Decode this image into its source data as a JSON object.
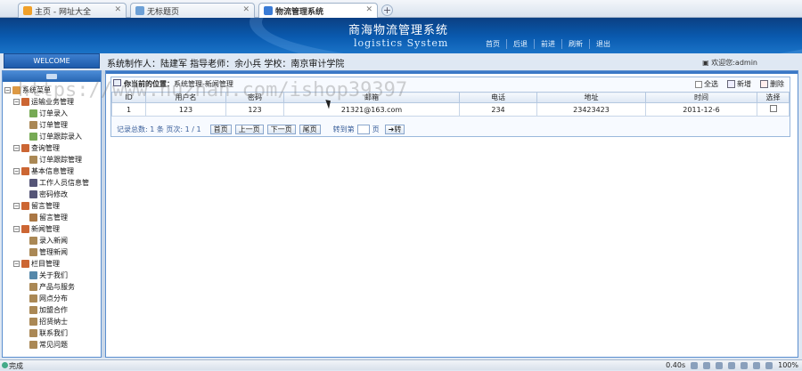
{
  "browser": {
    "tabs": [
      {
        "label": "主页 - 网址大全",
        "active": false
      },
      {
        "label": "无标题页",
        "active": false
      },
      {
        "label": "物流管理系统",
        "active": true
      }
    ],
    "new_tab": "+"
  },
  "header": {
    "title": "商海物流管理系统",
    "subtitle": "logistics System",
    "nav": [
      "首页",
      "后退",
      "前进",
      "刷新",
      "退出"
    ]
  },
  "welcome": "WELCOME",
  "credit": "系统制作人：陆建军 指导老师：余小兵 学校：南京审计学院",
  "user": "欢迎您:admin",
  "tree": {
    "root": "系统菜单",
    "groups": [
      {
        "label": "运输业务管理",
        "items": [
          "订单录入",
          "订单管理",
          "订单跟踪录入"
        ]
      },
      {
        "label": "查询管理",
        "items": [
          "订单跟踪管理"
        ]
      },
      {
        "label": "基本信息管理",
        "items": [
          "工作人员信息管",
          "密码修改"
        ]
      },
      {
        "label": "留言管理",
        "items": [
          "留言管理"
        ]
      },
      {
        "label": "新闻管理",
        "items": [
          "录入新闻",
          "管理新闻"
        ]
      },
      {
        "label": "栏目管理",
        "items": [
          "关于我们",
          "产品与服务",
          "网点分布",
          "加盟合作",
          "招贤纳士",
          "联系我们",
          "常见问题"
        ]
      }
    ]
  },
  "panel": {
    "location_label": "你当前的位置：",
    "location": "系统管理-新闻管理",
    "actions": {
      "select_all": "全选",
      "add": "新增",
      "delete": "删除"
    },
    "columns": [
      "ID",
      "用户名",
      "密码",
      "邮箱",
      "电话",
      "地址",
      "时间",
      "选择"
    ],
    "rows": [
      [
        "1",
        "123",
        "123",
        "21321@163.com",
        "234",
        "23423423",
        "2011-12-6"
      ]
    ],
    "pager": {
      "summary": "记录总数: 1 条  页次: 1 / 1",
      "first": "首页",
      "prev": "上一页",
      "next": "下一页",
      "last": "尾页",
      "goto_label": "转到第",
      "page_unit": "页",
      "go": "转"
    }
  },
  "watermark": "https://www.huzhan.com/ishop39397",
  "status": {
    "left": "完成",
    "timer": "0.40s",
    "zoom": "100%"
  }
}
